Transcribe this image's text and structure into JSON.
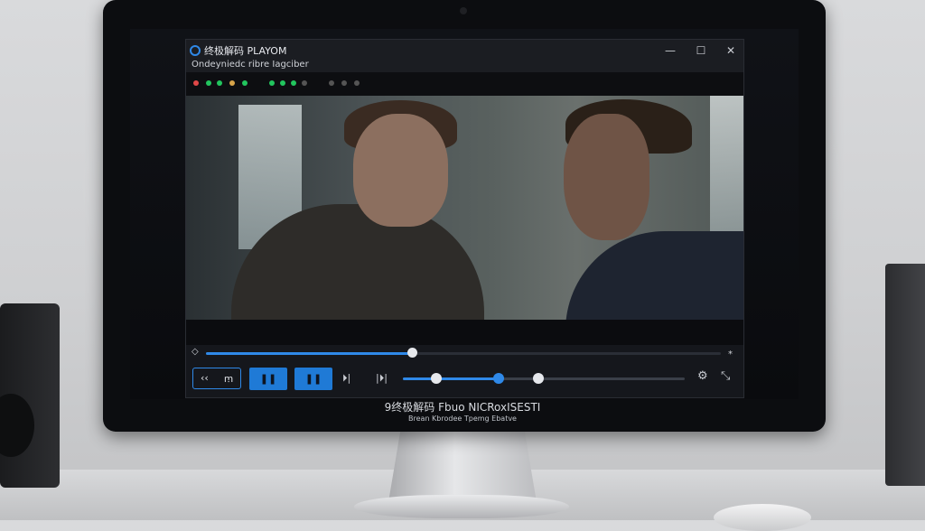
{
  "app": {
    "title": "终极解码 PLAYOM",
    "subtitle": "Ondeyniedc ribre Iagciber"
  },
  "window_controls": {
    "minimize": "—",
    "maximize": "☐",
    "close": "✕"
  },
  "status_dots": {
    "colors": [
      "#e04848",
      "#22c55e",
      "#22c55e",
      "#d7a44a",
      "#22c55e",
      "#22c55e",
      "#22c55e",
      "#22c55e",
      "#555",
      "#555",
      "#555",
      "#555"
    ]
  },
  "video": {
    "description": ""
  },
  "seek": {
    "left_icon": "◇",
    "right_icon": "⁎",
    "progress_fraction": 0.4
  },
  "controls": {
    "rewind_label": "‹‹",
    "skip_label": "ꭑ",
    "pause1_label": "❚❚",
    "pause2_label": "❚❚",
    "step_label": "⏵|",
    "next_label": "|⏵|",
    "secondary_slider": {
      "fill_fraction": 0.34,
      "knobs": [
        0.12,
        0.34,
        0.48
      ]
    },
    "settings_icon": "⚙",
    "fullscreen_icon": "⤡"
  },
  "monitor_caption": {
    "line1": "9终极解码 Fbuo NICRoxISESTI",
    "line2": "Brean Kbrodee Tpemg Ebatve"
  }
}
